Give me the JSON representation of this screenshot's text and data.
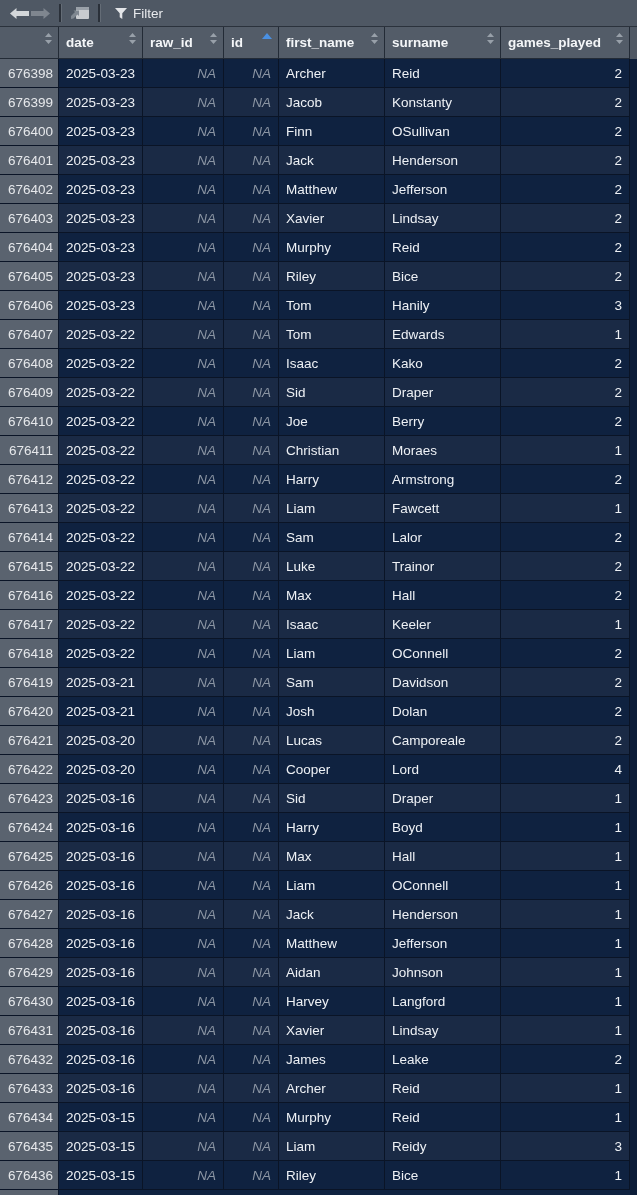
{
  "toolbar": {
    "buttons": [
      {
        "kind": "back",
        "disabled": false
      },
      {
        "kind": "forward",
        "disabled": true
      },
      {
        "kind": "popout",
        "disabled": false
      }
    ],
    "filter": {
      "label": "Filter"
    }
  },
  "table": {
    "row_number_column": {
      "sorted": false
    },
    "columns": [
      {
        "label": "date",
        "kind": "date",
        "sorted": false
      },
      {
        "label": "raw_id",
        "kind": "numeric",
        "sorted": false
      },
      {
        "label": "id",
        "kind": "numeric",
        "sorted": true
      },
      {
        "label": "first_name",
        "kind": "text",
        "sorted": false
      },
      {
        "label": "surname",
        "kind": "text",
        "sorted": false
      },
      {
        "label": "games_played",
        "kind": "numeric",
        "sorted": false
      }
    ],
    "rows": [
      {
        "row_number": "676398",
        "cells": [
          "2025-03-23",
          "NA",
          "NA",
          "Archer",
          "Reid",
          "2"
        ],
        "missing": [
          false,
          true,
          true,
          false,
          false,
          false
        ]
      },
      {
        "row_number": "676399",
        "cells": [
          "2025-03-23",
          "NA",
          "NA",
          "Jacob",
          "Konstanty",
          "2"
        ],
        "missing": [
          false,
          true,
          true,
          false,
          false,
          false
        ]
      },
      {
        "row_number": "676400",
        "cells": [
          "2025-03-23",
          "NA",
          "NA",
          "Finn",
          "OSullivan",
          "2"
        ],
        "missing": [
          false,
          true,
          true,
          false,
          false,
          false
        ]
      },
      {
        "row_number": "676401",
        "cells": [
          "2025-03-23",
          "NA",
          "NA",
          "Jack",
          "Henderson",
          "2"
        ],
        "missing": [
          false,
          true,
          true,
          false,
          false,
          false
        ]
      },
      {
        "row_number": "676402",
        "cells": [
          "2025-03-23",
          "NA",
          "NA",
          "Matthew",
          "Jefferson",
          "2"
        ],
        "missing": [
          false,
          true,
          true,
          false,
          false,
          false
        ]
      },
      {
        "row_number": "676403",
        "cells": [
          "2025-03-23",
          "NA",
          "NA",
          "Xavier",
          "Lindsay",
          "2"
        ],
        "missing": [
          false,
          true,
          true,
          false,
          false,
          false
        ]
      },
      {
        "row_number": "676404",
        "cells": [
          "2025-03-23",
          "NA",
          "NA",
          "Murphy",
          "Reid",
          "2"
        ],
        "missing": [
          false,
          true,
          true,
          false,
          false,
          false
        ]
      },
      {
        "row_number": "676405",
        "cells": [
          "2025-03-23",
          "NA",
          "NA",
          "Riley",
          "Bice",
          "2"
        ],
        "missing": [
          false,
          true,
          true,
          false,
          false,
          false
        ]
      },
      {
        "row_number": "676406",
        "cells": [
          "2025-03-23",
          "NA",
          "NA",
          "Tom",
          "Hanily",
          "3"
        ],
        "missing": [
          false,
          true,
          true,
          false,
          false,
          false
        ]
      },
      {
        "row_number": "676407",
        "cells": [
          "2025-03-22",
          "NA",
          "NA",
          "Tom",
          "Edwards",
          "1"
        ],
        "missing": [
          false,
          true,
          true,
          false,
          false,
          false
        ]
      },
      {
        "row_number": "676408",
        "cells": [
          "2025-03-22",
          "NA",
          "NA",
          "Isaac",
          "Kako",
          "2"
        ],
        "missing": [
          false,
          true,
          true,
          false,
          false,
          false
        ]
      },
      {
        "row_number": "676409",
        "cells": [
          "2025-03-22",
          "NA",
          "NA",
          "Sid",
          "Draper",
          "2"
        ],
        "missing": [
          false,
          true,
          true,
          false,
          false,
          false
        ]
      },
      {
        "row_number": "676410",
        "cells": [
          "2025-03-22",
          "NA",
          "NA",
          "Joe",
          "Berry",
          "2"
        ],
        "missing": [
          false,
          true,
          true,
          false,
          false,
          false
        ]
      },
      {
        "row_number": "676411",
        "cells": [
          "2025-03-22",
          "NA",
          "NA",
          "Christian",
          "Moraes",
          "1"
        ],
        "missing": [
          false,
          true,
          true,
          false,
          false,
          false
        ]
      },
      {
        "row_number": "676412",
        "cells": [
          "2025-03-22",
          "NA",
          "NA",
          "Harry",
          "Armstrong",
          "2"
        ],
        "missing": [
          false,
          true,
          true,
          false,
          false,
          false
        ]
      },
      {
        "row_number": "676413",
        "cells": [
          "2025-03-22",
          "NA",
          "NA",
          "Liam",
          "Fawcett",
          "1"
        ],
        "missing": [
          false,
          true,
          true,
          false,
          false,
          false
        ]
      },
      {
        "row_number": "676414",
        "cells": [
          "2025-03-22",
          "NA",
          "NA",
          "Sam",
          "Lalor",
          "2"
        ],
        "missing": [
          false,
          true,
          true,
          false,
          false,
          false
        ]
      },
      {
        "row_number": "676415",
        "cells": [
          "2025-03-22",
          "NA",
          "NA",
          "Luke",
          "Trainor",
          "2"
        ],
        "missing": [
          false,
          true,
          true,
          false,
          false,
          false
        ]
      },
      {
        "row_number": "676416",
        "cells": [
          "2025-03-22",
          "NA",
          "NA",
          "Max",
          "Hall",
          "2"
        ],
        "missing": [
          false,
          true,
          true,
          false,
          false,
          false
        ]
      },
      {
        "row_number": "676417",
        "cells": [
          "2025-03-22",
          "NA",
          "NA",
          "Isaac",
          "Keeler",
          "1"
        ],
        "missing": [
          false,
          true,
          true,
          false,
          false,
          false
        ]
      },
      {
        "row_number": "676418",
        "cells": [
          "2025-03-22",
          "NA",
          "NA",
          "Liam",
          "OConnell",
          "2"
        ],
        "missing": [
          false,
          true,
          true,
          false,
          false,
          false
        ]
      },
      {
        "row_number": "676419",
        "cells": [
          "2025-03-21",
          "NA",
          "NA",
          "Sam",
          "Davidson",
          "2"
        ],
        "missing": [
          false,
          true,
          true,
          false,
          false,
          false
        ]
      },
      {
        "row_number": "676420",
        "cells": [
          "2025-03-21",
          "NA",
          "NA",
          "Josh",
          "Dolan",
          "2"
        ],
        "missing": [
          false,
          true,
          true,
          false,
          false,
          false
        ]
      },
      {
        "row_number": "676421",
        "cells": [
          "2025-03-20",
          "NA",
          "NA",
          "Lucas",
          "Camporeale",
          "2"
        ],
        "missing": [
          false,
          true,
          true,
          false,
          false,
          false
        ]
      },
      {
        "row_number": "676422",
        "cells": [
          "2025-03-20",
          "NA",
          "NA",
          "Cooper",
          "Lord",
          "4"
        ],
        "missing": [
          false,
          true,
          true,
          false,
          false,
          false
        ]
      },
      {
        "row_number": "676423",
        "cells": [
          "2025-03-16",
          "NA",
          "NA",
          "Sid",
          "Draper",
          "1"
        ],
        "missing": [
          false,
          true,
          true,
          false,
          false,
          false
        ]
      },
      {
        "row_number": "676424",
        "cells": [
          "2025-03-16",
          "NA",
          "NA",
          "Harry",
          "Boyd",
          "1"
        ],
        "missing": [
          false,
          true,
          true,
          false,
          false,
          false
        ]
      },
      {
        "row_number": "676425",
        "cells": [
          "2025-03-16",
          "NA",
          "NA",
          "Max",
          "Hall",
          "1"
        ],
        "missing": [
          false,
          true,
          true,
          false,
          false,
          false
        ]
      },
      {
        "row_number": "676426",
        "cells": [
          "2025-03-16",
          "NA",
          "NA",
          "Liam",
          "OConnell",
          "1"
        ],
        "missing": [
          false,
          true,
          true,
          false,
          false,
          false
        ]
      },
      {
        "row_number": "676427",
        "cells": [
          "2025-03-16",
          "NA",
          "NA",
          "Jack",
          "Henderson",
          "1"
        ],
        "missing": [
          false,
          true,
          true,
          false,
          false,
          false
        ]
      },
      {
        "row_number": "676428",
        "cells": [
          "2025-03-16",
          "NA",
          "NA",
          "Matthew",
          "Jefferson",
          "1"
        ],
        "missing": [
          false,
          true,
          true,
          false,
          false,
          false
        ]
      },
      {
        "row_number": "676429",
        "cells": [
          "2025-03-16",
          "NA",
          "NA",
          "Aidan",
          "Johnson",
          "1"
        ],
        "missing": [
          false,
          true,
          true,
          false,
          false,
          false
        ]
      },
      {
        "row_number": "676430",
        "cells": [
          "2025-03-16",
          "NA",
          "NA",
          "Harvey",
          "Langford",
          "1"
        ],
        "missing": [
          false,
          true,
          true,
          false,
          false,
          false
        ]
      },
      {
        "row_number": "676431",
        "cells": [
          "2025-03-16",
          "NA",
          "NA",
          "Xavier",
          "Lindsay",
          "1"
        ],
        "missing": [
          false,
          true,
          true,
          false,
          false,
          false
        ]
      },
      {
        "row_number": "676432",
        "cells": [
          "2025-03-16",
          "NA",
          "NA",
          "James",
          "Leake",
          "2"
        ],
        "missing": [
          false,
          true,
          true,
          false,
          false,
          false
        ]
      },
      {
        "row_number": "676433",
        "cells": [
          "2025-03-16",
          "NA",
          "NA",
          "Archer",
          "Reid",
          "1"
        ],
        "missing": [
          false,
          true,
          true,
          false,
          false,
          false
        ]
      },
      {
        "row_number": "676434",
        "cells": [
          "2025-03-15",
          "NA",
          "NA",
          "Murphy",
          "Reid",
          "1"
        ],
        "missing": [
          false,
          true,
          true,
          false,
          false,
          false
        ]
      },
      {
        "row_number": "676435",
        "cells": [
          "2025-03-15",
          "NA",
          "NA",
          "Liam",
          "Reidy",
          "3"
        ],
        "missing": [
          false,
          true,
          true,
          false,
          false,
          false
        ]
      },
      {
        "row_number": "676436",
        "cells": [
          "2025-03-15",
          "NA",
          "NA",
          "Riley",
          "Bice",
          "1"
        ],
        "missing": [
          false,
          true,
          true,
          false,
          false,
          false
        ]
      }
    ]
  }
}
